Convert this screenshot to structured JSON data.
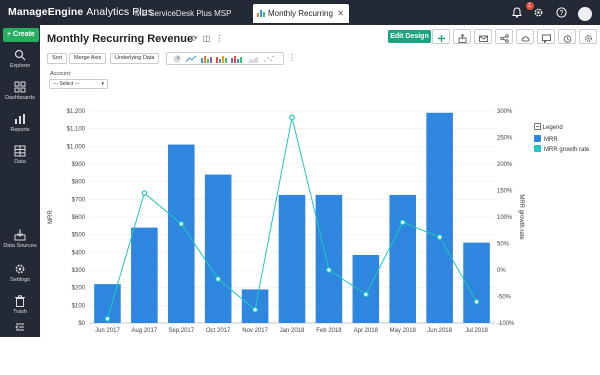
{
  "topbar": {
    "brand_bold": "ManageEngine",
    "brand_light": "Analytics Plus",
    "tabs": [
      {
        "label": "ME ServiceDesk Plus MSP Analytics"
      },
      {
        "label": "Monthly Recurring Reve..."
      }
    ],
    "notification_count": "1"
  },
  "sidebar": {
    "create_label": "+ Create",
    "items": [
      {
        "label": "Explorer"
      },
      {
        "label": "Dashboards"
      },
      {
        "label": "Reports"
      },
      {
        "label": "Data"
      },
      {
        "label": "Data Sources"
      },
      {
        "label": "Settings"
      },
      {
        "label": "Trash"
      }
    ]
  },
  "report": {
    "title": "Monthly Recurring Revenue",
    "edit_button": "Edit Design",
    "toolbar": {
      "sort": "Sort",
      "merge_axis": "Merge Axis",
      "underlying_data": "Underlying Data"
    },
    "filter": {
      "label": "Account:",
      "value": "--- Select ---"
    }
  },
  "colors": {
    "bar": "#2e86de",
    "line": "#1fc8c0",
    "topbar": "#232a35",
    "accent": "#1aa57e"
  },
  "chart_data": {
    "type": "bar",
    "categories": [
      "Jun 2017",
      "Aug 2017",
      "Sep 2017",
      "Oct 2017",
      "Nov 2017",
      "Jan 2018",
      "Feb 2018",
      "Apr 2018",
      "May 2018",
      "Jun 2018",
      "Jul 2018"
    ],
    "series": [
      {
        "name": "MRR",
        "type": "bar",
        "axis": "left",
        "values": [
          220,
          540,
          1010,
          840,
          190,
          725,
          725,
          385,
          725,
          1190,
          455
        ]
      },
      {
        "name": "MRR growth rate",
        "type": "line",
        "axis": "right",
        "values": [
          -92,
          145,
          87,
          -17,
          -75,
          288,
          0,
          -46,
          90,
          62,
          -60
        ]
      }
    ],
    "ylabel": "MRR",
    "y2label": "MRR growth rate",
    "ylim": [
      0,
      1200
    ],
    "y2lim": [
      -100,
      300
    ],
    "yticks": [
      "$0",
      "$100",
      "$200",
      "$300",
      "$400",
      "$500",
      "$600",
      "$700",
      "$800",
      "$900",
      "$1,000",
      "$1,100",
      "$1,200"
    ],
    "y2ticks": [
      "-100%",
      "-50%",
      "0%",
      "50%",
      "100%",
      "150%",
      "200%",
      "250%",
      "300%"
    ],
    "legend_title": "Legend",
    "legend_position": "right",
    "grid": true
  }
}
